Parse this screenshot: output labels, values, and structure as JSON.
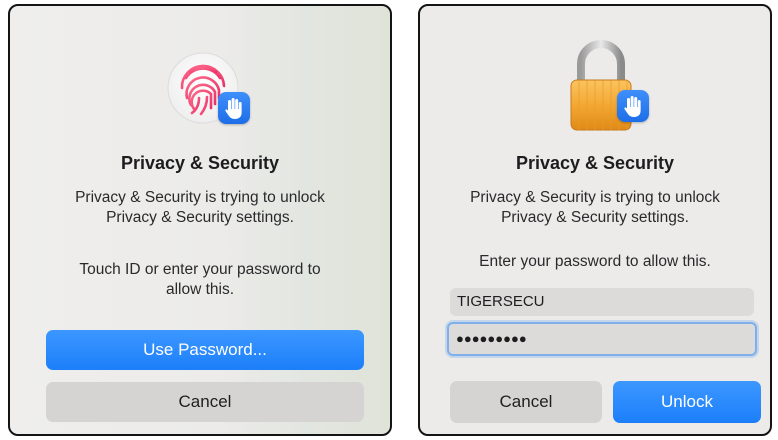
{
  "left_dialog": {
    "title": "Privacy & Security",
    "message_line1": "Privacy & Security is trying to unlock",
    "message_line2": "Privacy & Security settings.",
    "prompt_line1": "Touch ID or enter your password to",
    "prompt_line2": "allow this.",
    "use_password_label": "Use Password...",
    "cancel_label": "Cancel",
    "icon": "fingerprint-icon"
  },
  "right_dialog": {
    "title": "Privacy & Security",
    "message_line1": "Privacy & Security is trying to unlock",
    "message_line2": "Privacy & Security settings.",
    "prompt": "Enter your password to allow this.",
    "username_value": "TIGERSECU",
    "password_masked": "●●●●●●●●●",
    "cancel_label": "Cancel",
    "unlock_label": "Unlock",
    "icon": "lock-icon"
  },
  "colors": {
    "accent": "#1c7ffa",
    "button_gray": "#d5d4d3",
    "focus_ring": "#7fb0ec"
  }
}
